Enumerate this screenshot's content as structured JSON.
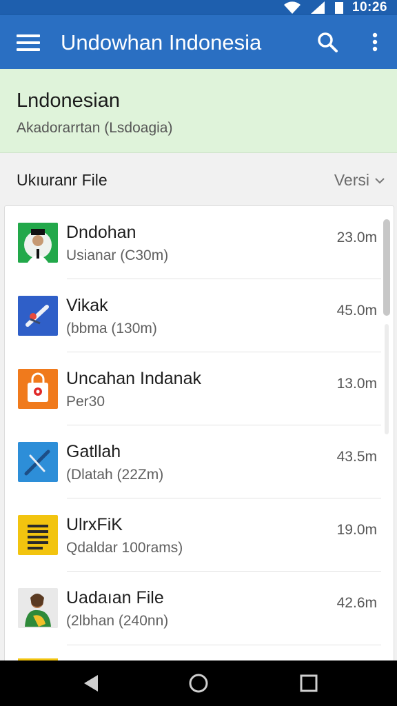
{
  "status": {
    "time": "10:26"
  },
  "appbar": {
    "title": "Undowhan Indonesia",
    "menu_icon": "hamburger-menu-icon",
    "search_icon": "search-icon",
    "more_icon": "more-vert-icon"
  },
  "banner": {
    "heading": "Lndonesian",
    "subtitle": "Akadorarrtan (Lsdoagia)"
  },
  "sortbar": {
    "left_label": "Ukıuranr File",
    "right_label": "Versi"
  },
  "files": [
    {
      "name": "Dndohan",
      "sub": "Usianar (C30m)",
      "size": "23.0m",
      "icon": "person-photo-icon",
      "color": "#22a84a"
    },
    {
      "name": "Vikak",
      "sub": "(bbma (130m)",
      "size": "45.0m",
      "icon": "brush-icon",
      "color": "#2f5fc8"
    },
    {
      "name": "Uncahan Indanak",
      "sub": "Per30",
      "size": "13.0m",
      "icon": "shopping-bag-icon",
      "color": "#f07a1c"
    },
    {
      "name": "Gatllah",
      "sub": "(Dlatah (22Zm)",
      "size": "43.5m",
      "icon": "pencil-icon",
      "color": "#2d8ed8"
    },
    {
      "name": "UlrxFiK",
      "sub": "Qdaldar 100rams)",
      "size": "19.0m",
      "icon": "document-lines-icon",
      "color": "#f2c40f"
    },
    {
      "name": "Uadaıan File",
      "sub": "(2lbhan (240nn)",
      "size": "42.6m",
      "icon": "avatar-illustration-icon",
      "color": "#e9e9e9"
    }
  ],
  "nav": {
    "back_icon": "back-icon",
    "home_icon": "home-icon",
    "recents_icon": "recents-icon"
  }
}
